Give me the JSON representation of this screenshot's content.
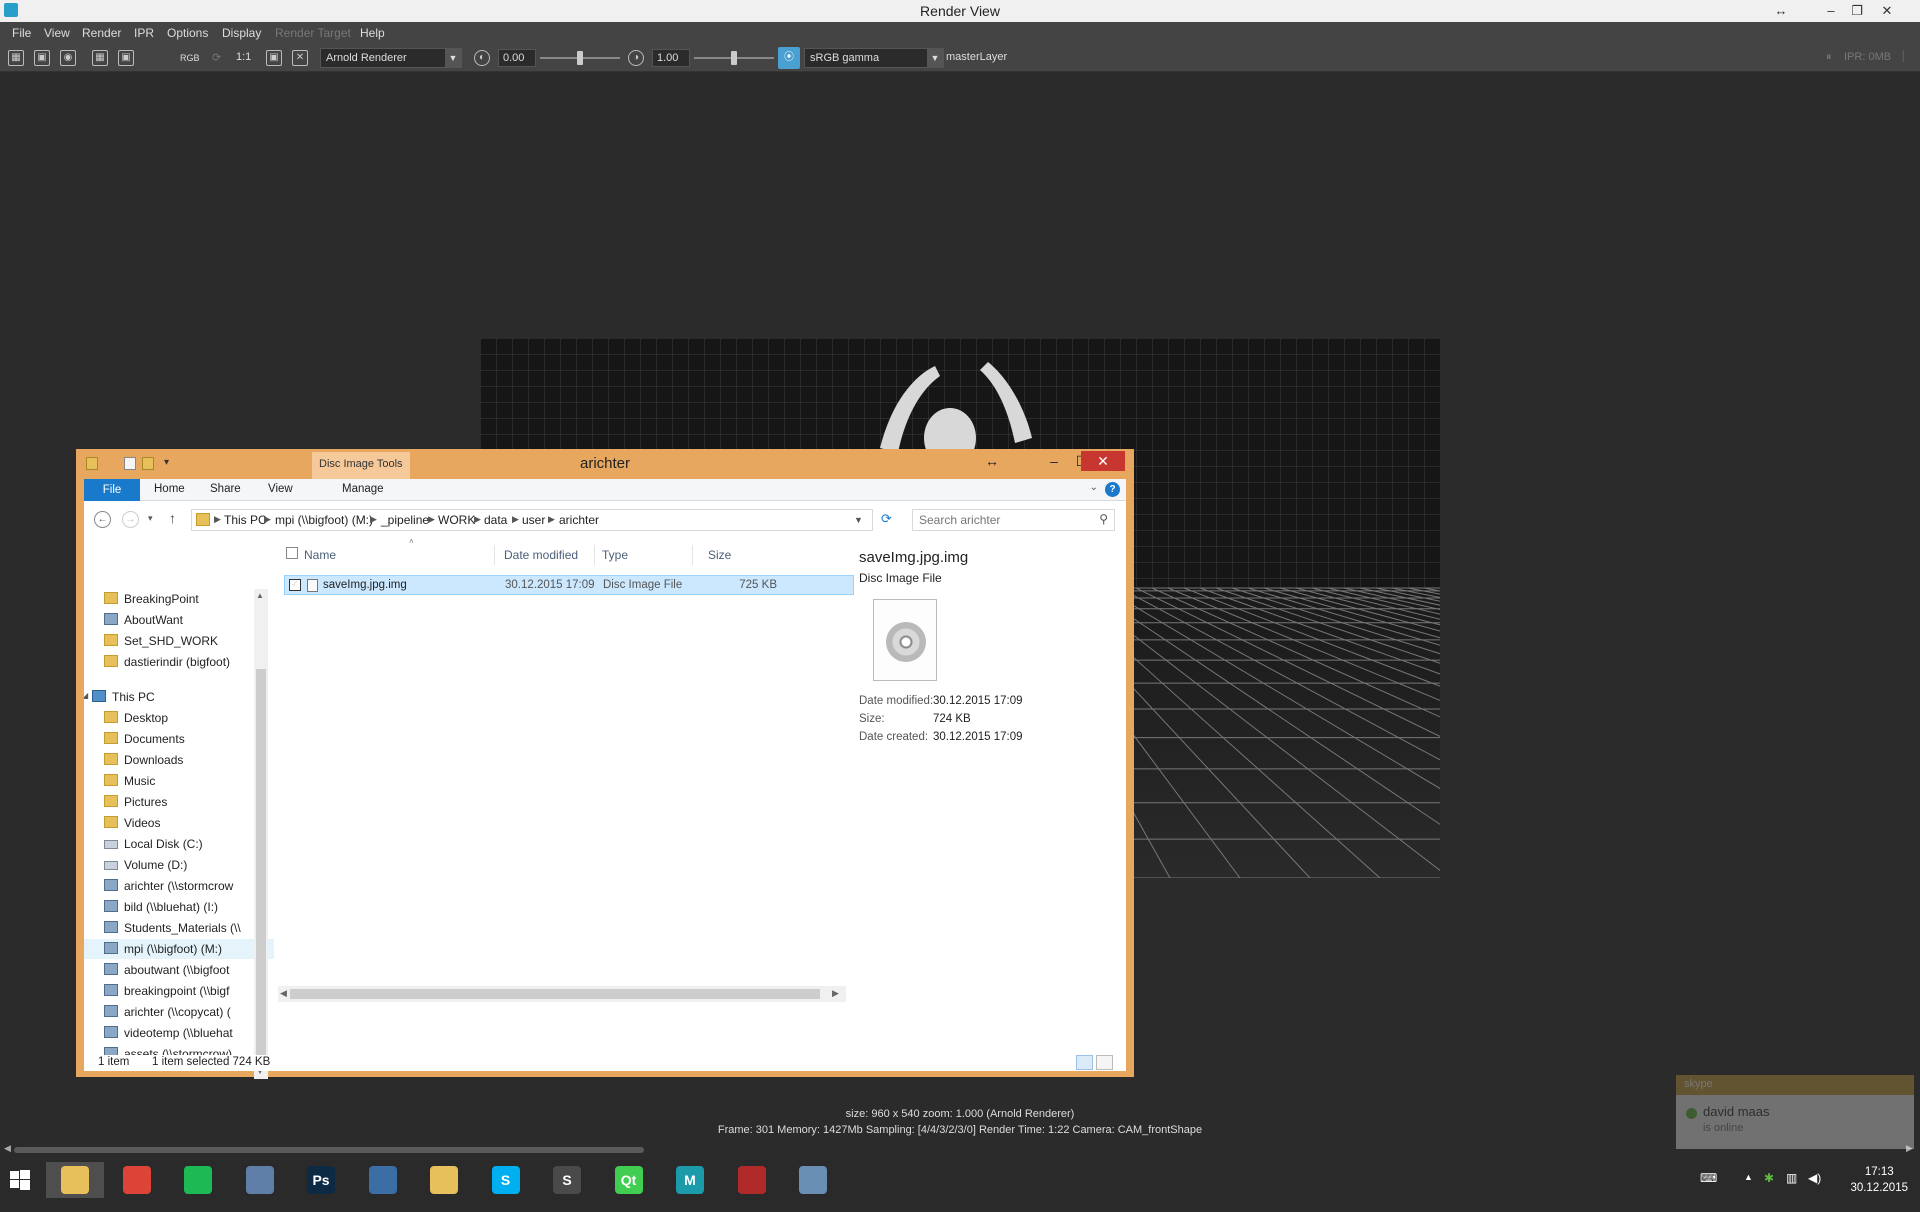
{
  "render_view": {
    "title": "Render View",
    "menu": [
      "File",
      "View",
      "Render",
      "IPR",
      "Options",
      "Display",
      "Render Target",
      "Help"
    ],
    "toolbar": {
      "rgb_label": "RGB",
      "ratio_label": "1:1",
      "renderer": "Arnold Renderer",
      "exposure_value": "0.00",
      "gamma_value": "1.00",
      "colorspace": "sRGB gamma",
      "layer": "masterLayer",
      "ipr_status": "IPR: 0MB"
    },
    "status": {
      "line1": "size: 960 x 540  zoom: 1.000      (Arnold Renderer)",
      "line2": "Frame: 301     Memory: 1427Mb     Sampling: [4/4/3/2/3/0]     Render Time: 1:22     Camera: CAM_frontShape"
    }
  },
  "skype_toast": {
    "header": "skype",
    "name": "david maas",
    "status": "is online"
  },
  "explorer": {
    "title": "arichter",
    "context_tab": "Disc Image Tools",
    "ribbon_tabs": [
      "File",
      "Home",
      "Share",
      "View",
      "Manage"
    ],
    "breadcrumb": [
      "This PC",
      "mpi (\\\\bigfoot) (M:)",
      "_pipeline",
      "WORK",
      "data",
      "user",
      "arichter"
    ],
    "search_placeholder": "Search arichter",
    "nav_items": [
      {
        "label": "BreakingPoint",
        "icon": "folder-icon"
      },
      {
        "label": "AboutWant",
        "icon": "network-drive-icon"
      },
      {
        "label": "Set_SHD_WORK",
        "icon": "folder-icon"
      },
      {
        "label": "dastierindir (bigfoot)",
        "icon": "folder-icon"
      },
      {
        "label": "This PC",
        "icon": "computer-icon"
      },
      {
        "label": "Desktop",
        "icon": "folder-icon"
      },
      {
        "label": "Documents",
        "icon": "folder-icon"
      },
      {
        "label": "Downloads",
        "icon": "folder-icon"
      },
      {
        "label": "Music",
        "icon": "folder-icon"
      },
      {
        "label": "Pictures",
        "icon": "folder-icon"
      },
      {
        "label": "Videos",
        "icon": "folder-icon"
      },
      {
        "label": "Local Disk (C:)",
        "icon": "drive-icon"
      },
      {
        "label": "Volume (D:)",
        "icon": "drive-icon"
      },
      {
        "label": "arichter (\\\\stormcrow",
        "icon": "network-drive-icon"
      },
      {
        "label": "bild (\\\\bluehat) (I:)",
        "icon": "network-drive-icon"
      },
      {
        "label": "Students_Materials (\\\\",
        "icon": "network-drive-icon"
      },
      {
        "label": "mpi (\\\\bigfoot) (M:)",
        "icon": "network-drive-icon",
        "selected": true
      },
      {
        "label": "aboutwant (\\\\bigfoot",
        "icon": "network-drive-icon"
      },
      {
        "label": "breakingpoint (\\\\bigf",
        "icon": "network-drive-icon"
      },
      {
        "label": "arichter (\\\\copycat) (",
        "icon": "network-drive-icon"
      },
      {
        "label": "videotemp (\\\\bluehat",
        "icon": "network-drive-icon"
      },
      {
        "label": "assets (\\\\stormcrow)",
        "icon": "network-drive-icon"
      }
    ],
    "columns": [
      "Name",
      "Date modified",
      "Type",
      "Size"
    ],
    "files": [
      {
        "name": "saveImg.jpg.img",
        "date": "30.12.2015 17:09",
        "type": "Disc Image File",
        "size": "725 KB",
        "selected": true
      }
    ],
    "preview": {
      "name": "saveImg.jpg.img",
      "type": "Disc Image File",
      "props": [
        {
          "key": "Date modified:",
          "value": "30.12.2015 17:09"
        },
        {
          "key": "Size:",
          "value": "724 KB"
        },
        {
          "key": "Date created:",
          "value": "30.12.2015 17:09"
        }
      ]
    },
    "status": {
      "count": "1 item",
      "selected": "1 item selected  724 KB"
    }
  },
  "taskbar": {
    "apps": [
      {
        "name": "file-explorer",
        "glyph": "",
        "color": "#e8c05b"
      },
      {
        "name": "chrome",
        "glyph": "",
        "color": "#db4437"
      },
      {
        "name": "spotify",
        "glyph": "",
        "color": "#1db954"
      },
      {
        "name": "app-globe",
        "glyph": "",
        "color": "#5f7fa8"
      },
      {
        "name": "photoshop",
        "glyph": "Ps",
        "color": "#0d2a45"
      },
      {
        "name": "thunderbird",
        "glyph": "",
        "color": "#3a6ea5"
      },
      {
        "name": "file-manager",
        "glyph": "",
        "color": "#e8c05b"
      },
      {
        "name": "skype",
        "glyph": "S",
        "color": "#00aff0"
      },
      {
        "name": "sublime",
        "glyph": "S",
        "color": "#4a4a4a"
      },
      {
        "name": "qt",
        "glyph": "Qt",
        "color": "#41cd52"
      },
      {
        "name": "maya",
        "glyph": "M",
        "color": "#1b9aaa"
      },
      {
        "name": "davinci",
        "glyph": "",
        "color": "#b02a2a"
      },
      {
        "name": "paint",
        "glyph": "",
        "color": "#6a8fb5"
      }
    ],
    "clock_time": "17:13",
    "clock_date": "30.12.2015"
  }
}
